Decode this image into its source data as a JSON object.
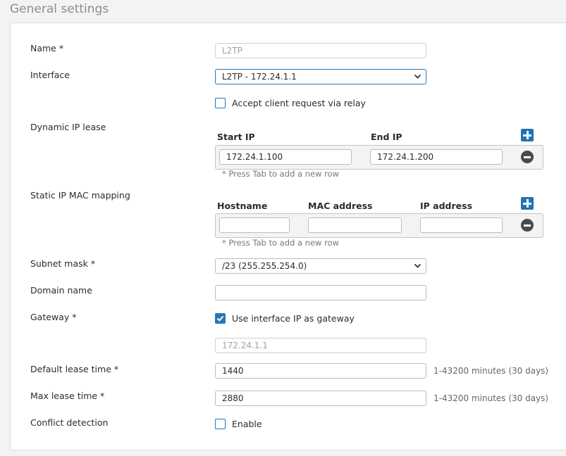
{
  "section": {
    "title": "General settings"
  },
  "labels": {
    "name": "Name *",
    "interface": "Interface",
    "dynamic_ip_lease": "Dynamic IP lease",
    "static_ip_mac": "Static IP MAC mapping",
    "subnet_mask": "Subnet mask *",
    "domain_name": "Domain name",
    "gateway": "Gateway *",
    "default_lease": "Default lease time *",
    "max_lease": "Max lease time *",
    "conflict_detection": "Conflict detection"
  },
  "name_field": {
    "value": "L2TP"
  },
  "interface_select": {
    "value": "L2TP - 172.24.1.1"
  },
  "relay_checkbox": {
    "label": "Accept client request via relay",
    "checked": false
  },
  "dynamic_lease": {
    "headers": {
      "start": "Start IP",
      "end": "End IP"
    },
    "rows": [
      {
        "start": "172.24.1.100",
        "end": "172.24.1.200"
      }
    ],
    "hint": "* Press Tab to add a new row"
  },
  "static_mapping": {
    "headers": {
      "hostname": "Hostname",
      "mac": "MAC address",
      "ip": "IP address"
    },
    "rows": [
      {
        "hostname": "",
        "mac": "",
        "ip": ""
      }
    ],
    "hint": "* Press Tab to add a new row"
  },
  "subnet_select": {
    "value": "/23 (255.255.254.0)"
  },
  "domain_field": {
    "value": ""
  },
  "gateway_checkbox": {
    "label": "Use interface IP as gateway",
    "checked": true
  },
  "gateway_field": {
    "value": "172.24.1.1"
  },
  "default_lease_field": {
    "value": "1440",
    "units": "1-43200 minutes (30 days)"
  },
  "max_lease_field": {
    "value": "2880",
    "units": "1-43200 minutes (30 days)"
  },
  "conflict_checkbox": {
    "label": "Enable",
    "checked": false
  },
  "colors": {
    "accent": "#2677b8",
    "remove": "#4a4a4a"
  }
}
